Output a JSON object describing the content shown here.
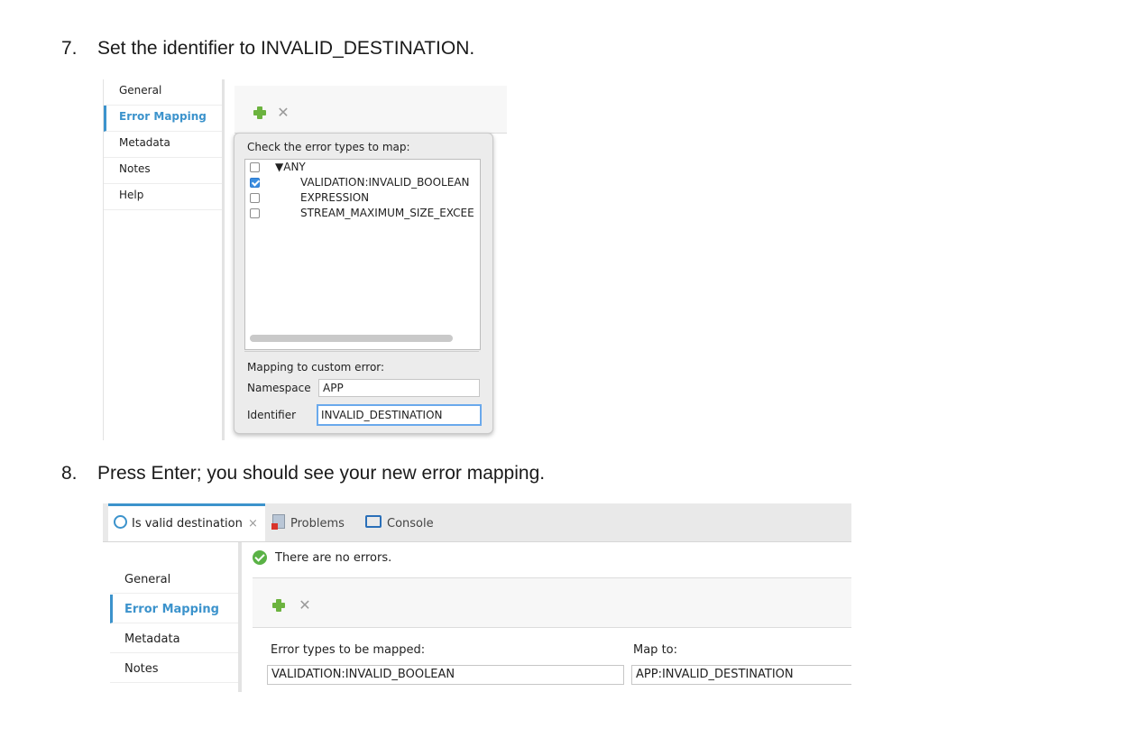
{
  "steps": [
    {
      "number": "7.",
      "text": "Set the identifier to INVALID_DESTINATION."
    },
    {
      "number": "8.",
      "text": "Press Enter; you should see your new error mapping."
    }
  ],
  "shot1": {
    "nav_items": [
      "General",
      "Error Mapping",
      "Metadata",
      "Notes",
      "Help"
    ],
    "active_nav": "Error Mapping",
    "toolbar": {
      "add_icon": "plus-icon",
      "remove_icon": "remove-icon"
    },
    "popup": {
      "caption": "Check the error types to map:",
      "tree": [
        {
          "label": "▼ANY",
          "checked": false
        },
        {
          "label": "VALIDATION:INVALID_BOOLEAN",
          "checked": true
        },
        {
          "label": "EXPRESSION",
          "checked": false
        },
        {
          "label": "STREAM_MAXIMUM_SIZE_EXCEE",
          "checked": false
        }
      ],
      "mapping_caption": "Mapping to custom error:",
      "namespace_label": "Namespace",
      "namespace_value": "APP",
      "identifier_label": "Identifier",
      "identifier_value": "INVALID_DESTINATION"
    }
  },
  "shot2": {
    "tabs": [
      {
        "label": "Is valid destination",
        "icon": "flow-icon",
        "close": "×"
      },
      {
        "label": "Problems",
        "icon": "problems-icon"
      },
      {
        "label": "Console",
        "icon": "console-icon"
      }
    ],
    "status_text": "There are no errors.",
    "nav_items": [
      "General",
      "Error Mapping",
      "Metadata",
      "Notes"
    ],
    "active_nav": "Error Mapping",
    "columns": {
      "left": "Error types to be mapped:",
      "right": "Map to:"
    },
    "row": {
      "error_type": "VALIDATION:INVALID_BOOLEAN",
      "map_to": "APP:INVALID_DESTINATION"
    },
    "colors": {
      "accent": "#3c93cc",
      "add_green": "#6cb33f",
      "ok_green": "#5ab246"
    }
  }
}
